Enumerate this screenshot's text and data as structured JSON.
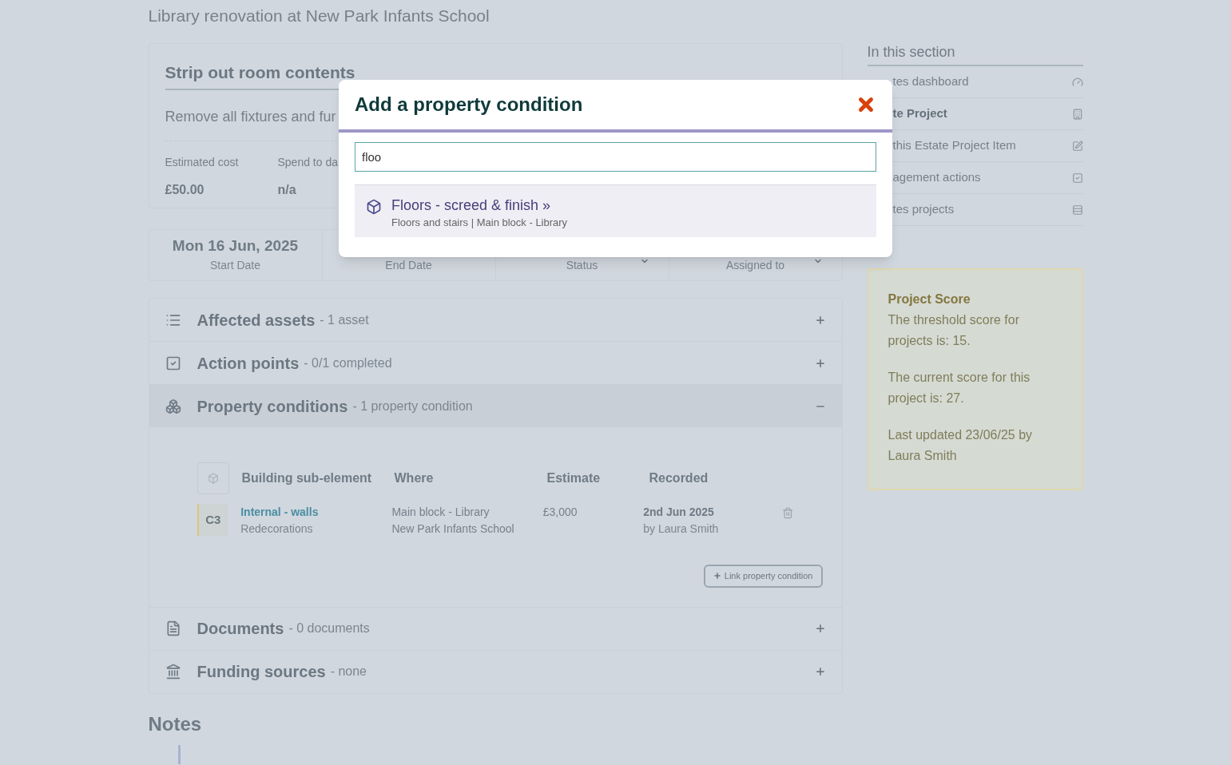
{
  "page_title": "Library renovation at New Park Infants School",
  "item": {
    "title": "Strip out room contents",
    "description": "Remove all fixtures and fur",
    "stats": [
      {
        "label": "Estimated cost",
        "value": "£50.00"
      },
      {
        "label": "Spend to da",
        "value": "n/a"
      }
    ]
  },
  "dates": [
    {
      "kind": "date",
      "value": "Mon 16 Jun, 2025",
      "label": "Start Date"
    },
    {
      "kind": "date",
      "label": "End Date"
    },
    {
      "kind": "select",
      "label": "Status"
    },
    {
      "kind": "select",
      "label": "Assigned to"
    }
  ],
  "sections": [
    {
      "title": "Affected assets",
      "summary": "- 1 asset",
      "expanded": false
    },
    {
      "title": "Action points",
      "summary": "- 0/1 completed",
      "expanded": false
    },
    {
      "title": "Property conditions",
      "summary": "- 1 property condition",
      "expanded": true,
      "table": {
        "columns": [
          "Building sub-element",
          "Where",
          "Estimate",
          "Recorded"
        ],
        "rows": [
          {
            "grade": "C3",
            "color": "#d9c77a",
            "element": "Internal - walls",
            "detail": "Redecorations",
            "where": "Main block - Library",
            "site": "New Park Infants School",
            "estimate": "£3,000",
            "date": "2nd Jun 2025",
            "by": "by Laura Smith"
          }
        ]
      },
      "link_button": "Link property condition"
    },
    {
      "title": "Documents",
      "summary": "- 0 documents",
      "expanded": false
    },
    {
      "title": "Funding sources",
      "summary": "- none",
      "expanded": false
    }
  ],
  "notes_heading": "Notes",
  "sidebar": {
    "heading": "In this section",
    "items": [
      {
        "label": "tes dashboard",
        "selected": false
      },
      {
        "label": "te Project",
        "selected": true
      },
      {
        "label": "this Estate Project Item",
        "selected": false
      },
      {
        "label": "agement actions",
        "selected": false
      },
      {
        "label": "tes projects",
        "selected": false
      }
    ]
  },
  "score": {
    "title": "Project Score",
    "paragraphs": [
      "The threshold score for projects is: 15.",
      "The current score for this project is: 27.",
      "Last updated 23/06/25 by Laura Smith"
    ]
  },
  "modal": {
    "title": "Add a property condition",
    "search_value": "floo",
    "results": [
      {
        "title": "Floors - screed & finish »",
        "subtitle": "Floors and stairs | Main block - Library"
      }
    ]
  }
}
